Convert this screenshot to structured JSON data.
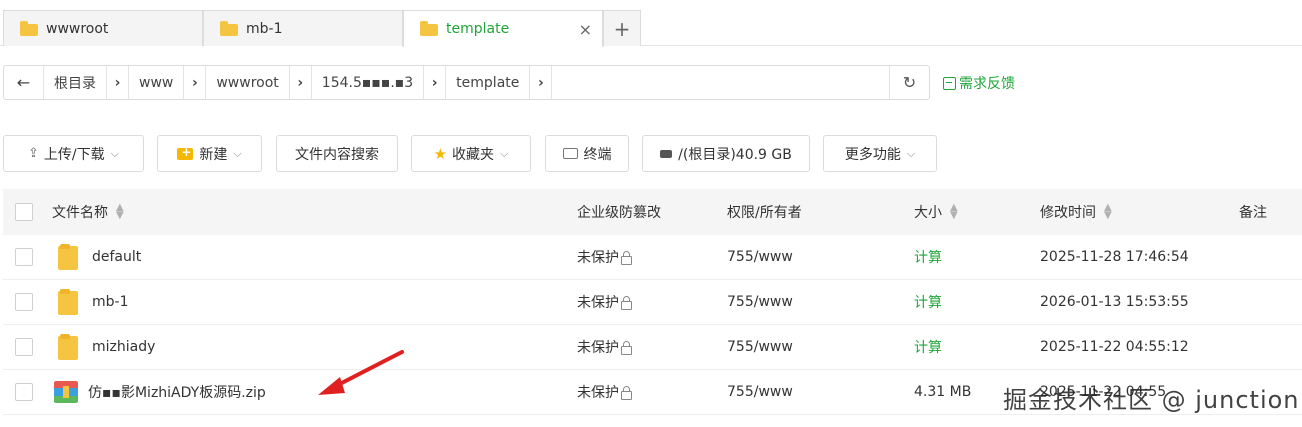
{
  "tabs": [
    {
      "label": "wwwroot",
      "active": false
    },
    {
      "label": "mb-1",
      "active": false
    },
    {
      "label": "template",
      "active": true
    }
  ],
  "tab_close": "×",
  "tab_add": "+",
  "breadcrumb": {
    "back": "←",
    "items": [
      "根目录",
      "www",
      "wwwroot",
      "154.5▪▪▪.▪3",
      "template"
    ],
    "separator": "›",
    "refresh": "↻"
  },
  "feedback_label": "需求反馈",
  "toolbar": {
    "upload": "上传/下载",
    "new": "新建",
    "search_content": "文件内容搜索",
    "favorites": "收藏夹",
    "terminal": "终端",
    "disk": "/(根目录)40.9 GB",
    "more": "更多功能",
    "caret": "⌵"
  },
  "table": {
    "headers": {
      "name": "文件名称",
      "protect": "企业级防篡改",
      "perm": "权限/所有者",
      "size": "大小",
      "mtime": "修改时间",
      "note": "备注"
    },
    "rows": [
      {
        "type": "folder",
        "name": "default",
        "protect": "未保护",
        "perm": "755/www",
        "size": "计算",
        "mtime": "2025-11-28 17:46:54"
      },
      {
        "type": "folder",
        "name": "mb-1",
        "protect": "未保护",
        "perm": "755/www",
        "size": "计算",
        "mtime": "2026-01-13 15:53:55"
      },
      {
        "type": "folder",
        "name": "mizhiady",
        "protect": "未保护",
        "perm": "755/www",
        "size": "计算",
        "mtime": "2025-11-22 04:55:12"
      },
      {
        "type": "zip",
        "name": "仿▪▪影MizhiADY板源码.zip",
        "protect": "未保护",
        "perm": "755/www",
        "size": "4.31 MB",
        "mtime": "2025-11-22 04:55"
      }
    ]
  },
  "watermark": "掘金技术社区 @ junction",
  "colors": {
    "accent": "#20a53a",
    "folder": "#f5c542",
    "arrow": "#e02020"
  }
}
